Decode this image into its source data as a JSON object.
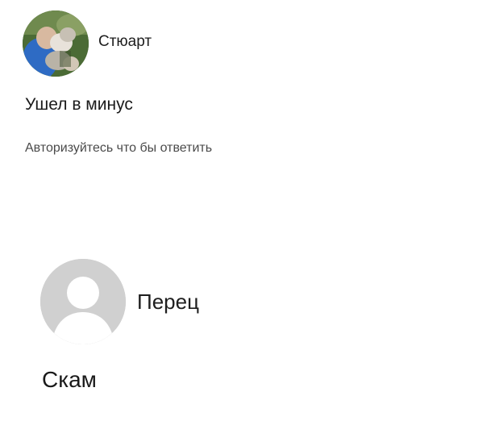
{
  "comments": [
    {
      "author": "Стюарт",
      "text": "Ушел в минус",
      "reply_prompt": "Авторизуйтесь что бы ответить",
      "avatar": "user-photo"
    },
    {
      "author": "Перец",
      "text": "Скам",
      "avatar": "default-user-silhouette"
    }
  ],
  "colors": {
    "text": "#1a1a1a",
    "secondary_text": "#4a4a4a",
    "default_avatar_bg": "#d0d0d0",
    "default_avatar_fg": "#ffffff"
  }
}
